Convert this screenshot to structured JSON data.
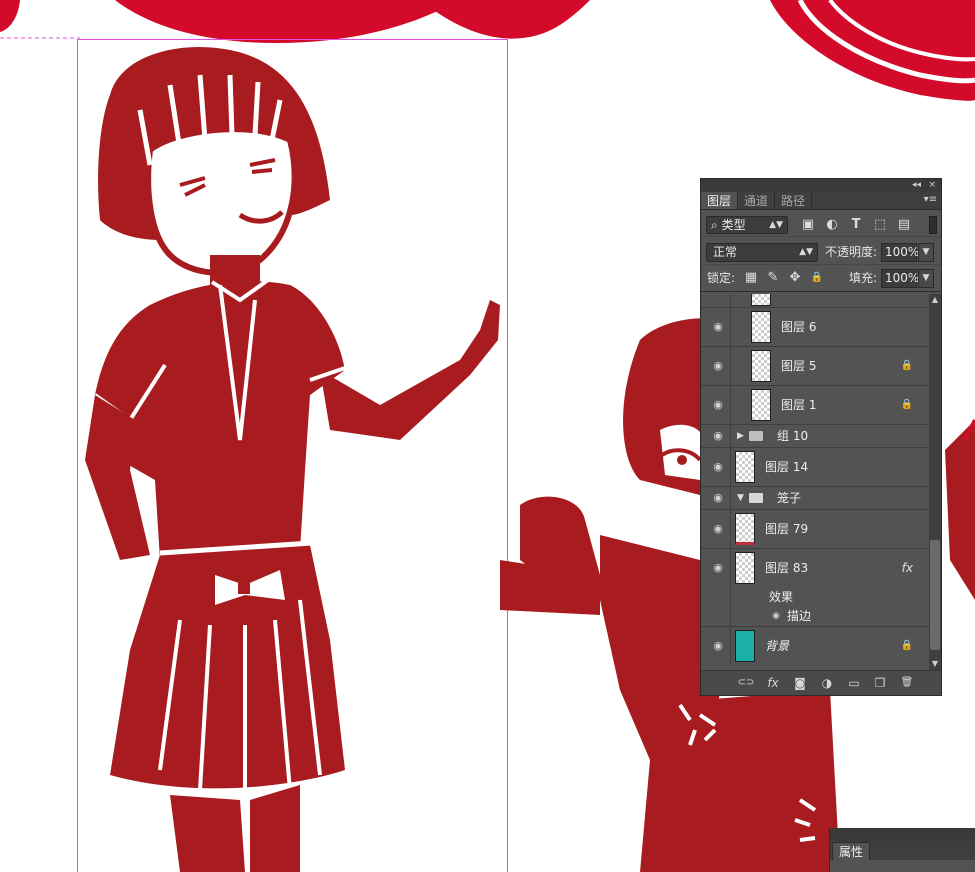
{
  "panel": {
    "tabs": [
      {
        "label": "图层",
        "active": true
      },
      {
        "label": "通道",
        "active": false
      },
      {
        "label": "路径",
        "active": false
      }
    ],
    "titlebar": {
      "collapse_icon": "double-chevron-left-icon",
      "close_glyph": "×",
      "collapse_glyph": "◂◂",
      "menu_glyph": "▾≡"
    },
    "filter": {
      "kind_label": "类型",
      "search_glyph": "⌕",
      "icons": [
        {
          "name": "pixel-layer-filter-icon",
          "glyph": "▣"
        },
        {
          "name": "adjustment-layer-filter-icon",
          "glyph": "◐"
        },
        {
          "name": "type-layer-filter-icon",
          "glyph": "T"
        },
        {
          "name": "shape-layer-filter-icon",
          "glyph": "⬚"
        },
        {
          "name": "smart-object-filter-icon",
          "glyph": "▤"
        }
      ]
    },
    "blend": {
      "mode": "正常",
      "opacity_label": "不透明度:",
      "opacity_value": "100%"
    },
    "lock": {
      "label": "锁定:",
      "icons": [
        {
          "name": "lock-transparent-pixels-icon",
          "glyph": "▦"
        },
        {
          "name": "lock-image-pixels-icon",
          "glyph": "✎"
        },
        {
          "name": "lock-position-icon",
          "glyph": "✥"
        },
        {
          "name": "lock-all-icon",
          "glyph": "🔒"
        }
      ],
      "fill_label": "填充:",
      "fill_value": "100%"
    },
    "layers": [
      {
        "name": "图层 6",
        "type": "pixel",
        "indent": 2,
        "locked": false
      },
      {
        "name": "图层 5",
        "type": "pixel",
        "indent": 2,
        "locked": true
      },
      {
        "name": "图层 1",
        "type": "pixel",
        "indent": 2,
        "locked": true
      },
      {
        "name": "组 10",
        "type": "group",
        "expanded": false
      },
      {
        "name": "图层 14",
        "type": "pixel",
        "indent": 1,
        "locked": false
      },
      {
        "name": "笼子",
        "type": "group",
        "expanded": true
      },
      {
        "name": "图层 79",
        "type": "pixel",
        "indent": 1,
        "locked": false
      },
      {
        "name": "图层 83",
        "type": "pixel",
        "indent": 1,
        "fx": true,
        "effects_label": "效果",
        "effect": "描边"
      },
      {
        "name": "背景",
        "type": "background",
        "locked": true
      }
    ],
    "footer_icons": [
      {
        "name": "link-layers-icon",
        "glyph": "⊂⊃"
      },
      {
        "name": "add-layer-style-icon",
        "glyph": "fx"
      },
      {
        "name": "add-layer-mask-icon",
        "glyph": "◙"
      },
      {
        "name": "new-adjustment-layer-icon",
        "glyph": "◑"
      },
      {
        "name": "new-group-icon",
        "glyph": "▭"
      },
      {
        "name": "new-layer-icon",
        "glyph": "❐"
      },
      {
        "name": "delete-layer-icon",
        "glyph": "🗑"
      }
    ],
    "fx_glyph": "fx",
    "lock_glyph": "🔒",
    "eye_glyph": "◉"
  },
  "properties": {
    "tab_label": "属性"
  },
  "colors": {
    "paper_cut_red": "#a81c1f",
    "banner_red": "#d30a2a",
    "guide_magenta": "#e04de0",
    "background_swatch": "#1bb0a9"
  }
}
